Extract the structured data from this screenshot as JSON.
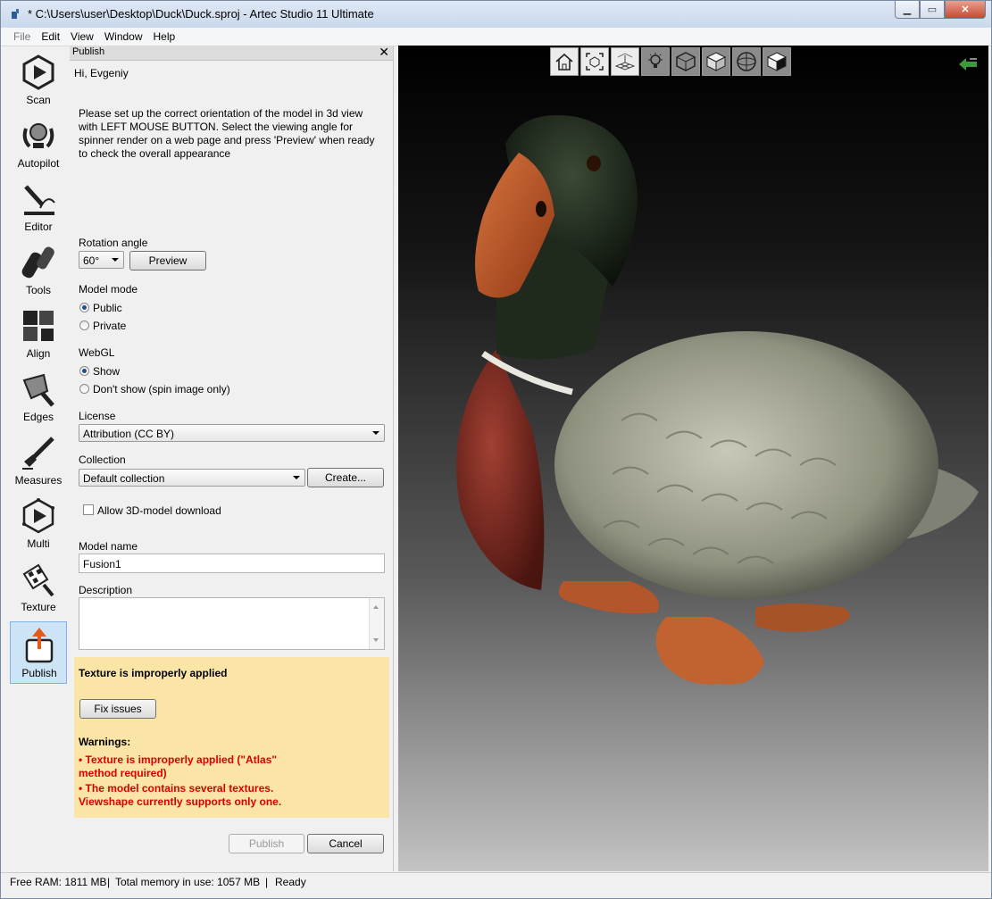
{
  "window": {
    "title": "* C:\\Users\\user\\Desktop\\Duck\\Duck.sproj - Artec Studio 11 Ultimate",
    "buttons": [
      "minimize",
      "maximize",
      "close"
    ]
  },
  "menubar": {
    "items": [
      "File",
      "Edit",
      "View",
      "Window",
      "Help"
    ]
  },
  "sidebar": {
    "items": [
      {
        "label": "Scan",
        "icon": "scan-icon"
      },
      {
        "label": "Autopilot",
        "icon": "autopilot-icon"
      },
      {
        "label": "Editor",
        "icon": "editor-icon"
      },
      {
        "label": "Tools",
        "icon": "tools-icon"
      },
      {
        "label": "Align",
        "icon": "align-icon"
      },
      {
        "label": "Edges",
        "icon": "edges-icon"
      },
      {
        "label": "Measures",
        "icon": "measures-icon"
      },
      {
        "label": "Multi",
        "icon": "multi-icon"
      },
      {
        "label": "Texture",
        "icon": "texture-icon"
      },
      {
        "label": "Publish",
        "icon": "publish-icon",
        "active": true
      }
    ]
  },
  "panel": {
    "title": "Publish",
    "greeting": "Hi, Evgeniy",
    "instructions": [
      "Please set up the correct orientation of the model in 3d view",
      "with LEFT MOUSE BUTTON. Select the viewing angle for",
      "spinner render on a web page and press 'Preview' when ready",
      "to check the overall appearance"
    ],
    "rotation_label": "Rotation angle",
    "rotation_value": "60°",
    "preview_button": "Preview",
    "model_mode_label": "Model mode",
    "model_mode_options": [
      "Public",
      "Private"
    ],
    "model_mode_selected": "Public",
    "webgl_label": "WebGL",
    "webgl_options": [
      "Show",
      "Don't show (spin image only)"
    ],
    "webgl_selected": "Show",
    "license_label": "License",
    "license_value": "Attribution (CC BY)",
    "collection_label": "Collection",
    "collection_value": "Default collection",
    "create_button": "Create...",
    "allow_download_label": "Allow 3D-model download",
    "allow_download_checked": false,
    "model_name_label": "Model name",
    "model_name_value": "Fusion1",
    "description_label": "Description",
    "description_value": "",
    "warning_box": {
      "headline": "Texture is improperly applied",
      "fix_button": "Fix issues",
      "warnings_title": "Warnings:",
      "warnings": [
        [
          "•  Texture is improperly applied (\"Atlas\"",
          "method required)"
        ],
        [
          "•  The model contains several textures.",
          "Viewshape currently supports only one."
        ]
      ]
    },
    "publish_button": "Publish",
    "cancel_button": "Cancel"
  },
  "viewport": {
    "toolbar": [
      "home-icon",
      "fit-view-icon",
      "grid-icon",
      "light-icon",
      "wireframe-cube-icon",
      "solid-cube-icon",
      "sphere-icon",
      "texture-cube-icon"
    ],
    "corner_icon": "back-arrow-icon"
  },
  "statusbar": {
    "free_ram": "Free RAM: 1811 MB",
    "total_memory": "Total memory in use: 1057 MB",
    "status": "Ready"
  }
}
